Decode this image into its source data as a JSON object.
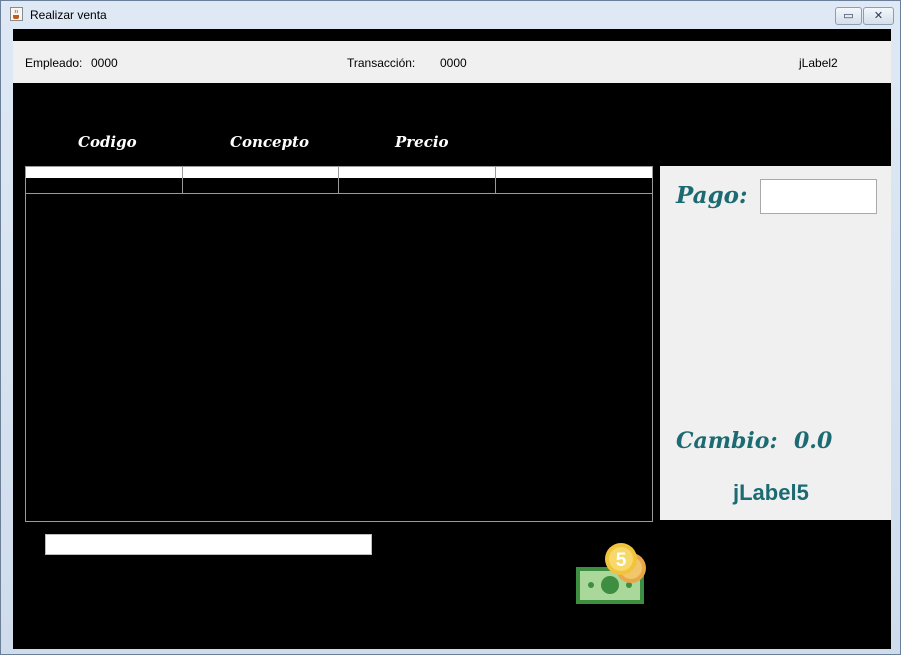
{
  "window": {
    "title": "Realizar venta",
    "minimize_symbol": "▭",
    "close_symbol": "✕"
  },
  "infobar": {
    "empleado_label": "Empleado:",
    "empleado_value": "0000",
    "transaccion_label": "Transacción:",
    "transaccion_value": "0000",
    "jlabel2": "jLabel2"
  },
  "columns": [
    "Codigo",
    "Concepto",
    "Precio"
  ],
  "table": {
    "column_count": 4,
    "rows": [
      [
        "",
        "",
        "",
        ""
      ]
    ]
  },
  "payment": {
    "pago_label": "Pago:",
    "pago_value": "",
    "cambio_label": "Cambio:",
    "cambio_value": "0.0",
    "jlabel5": "jLabel5"
  },
  "scan_input_value": "",
  "icons": {
    "coin_number": "5"
  },
  "colors": {
    "accent_teal": "#1c6b72",
    "background_black": "#000000",
    "panel_gray": "#f0f0f0"
  }
}
